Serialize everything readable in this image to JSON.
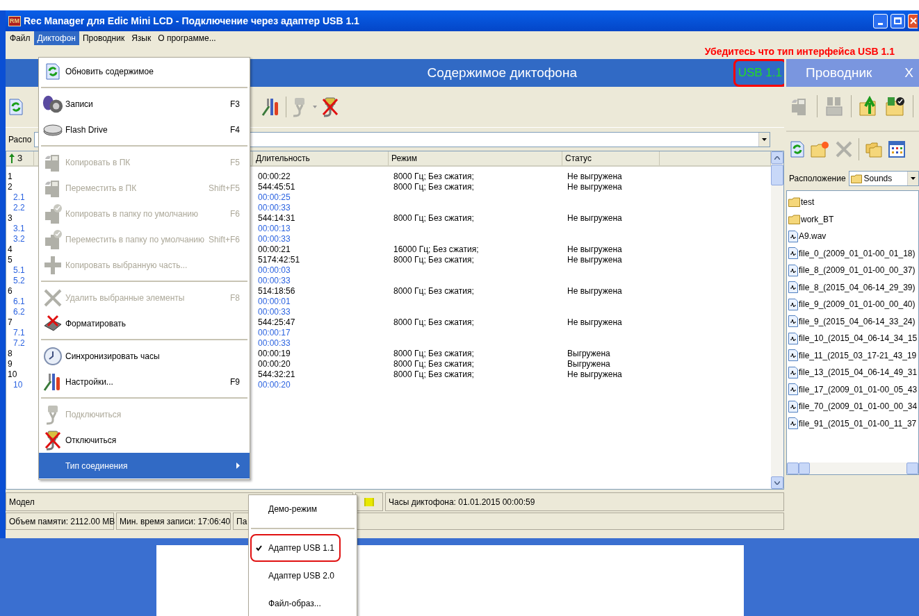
{
  "window": {
    "app_icon": "RM",
    "title": "Rec Manager для Edic Mini LCD - Подключение через адаптер USB 1.1"
  },
  "menu_bar": [
    {
      "label": "Файл",
      "selected": false
    },
    {
      "label": "Диктофон",
      "selected": true
    },
    {
      "label": "Проводник",
      "selected": false
    },
    {
      "label": "Язык",
      "selected": false
    },
    {
      "label": "О программе...",
      "selected": false
    }
  ],
  "annotation": "Убедитесь что тип интерфейса USB 1.1",
  "recorder": {
    "title": "Содержимое диктофона",
    "interface": "USB 1.1",
    "location_label": "Распо",
    "columns": [
      "З",
      "Длительность",
      "Режим",
      "Статус"
    ],
    "rows": [
      {
        "kind": "record",
        "number": "1",
        "duration": "00:00:22",
        "mode": "8000 Гц; Без сжатия;",
        "status": "Не выгружена"
      },
      {
        "kind": "record",
        "number": "2",
        "duration": "544:45:51",
        "mode": "8000 Гц; Без сжатия;",
        "status": "Не выгружена"
      },
      {
        "kind": "part",
        "number": "2.1",
        "duration": "00:00:25"
      },
      {
        "kind": "part",
        "number": "2.2",
        "duration": "00:00:33"
      },
      {
        "kind": "record",
        "number": "3",
        "duration": "544:14:31",
        "mode": "8000 Гц; Без сжатия;",
        "status": "Не выгружена"
      },
      {
        "kind": "part",
        "number": "3.1",
        "duration": "00:00:13"
      },
      {
        "kind": "part",
        "number": "3.2",
        "duration": "00:00:33"
      },
      {
        "kind": "record",
        "number": "4",
        "duration": "00:00:21",
        "mode": "16000 Гц; Без сжатия;",
        "status": "Не выгружена"
      },
      {
        "kind": "record",
        "number": "5",
        "duration": "5174:42:51",
        "mode": "8000 Гц; Без сжатия;",
        "status": "Не выгружена"
      },
      {
        "kind": "part",
        "number": "5.1",
        "duration": "00:00:03"
      },
      {
        "kind": "part",
        "number": "5.2",
        "duration": "00:00:33"
      },
      {
        "kind": "record",
        "number": "6",
        "duration": "514:18:56",
        "mode": "8000 Гц; Без сжатия;",
        "status": "Не выгружена"
      },
      {
        "kind": "part",
        "number": "6.1",
        "duration": "00:00:01"
      },
      {
        "kind": "part",
        "number": "6.2",
        "duration": "00:00:33"
      },
      {
        "kind": "record",
        "number": "7",
        "duration": "544:25:47",
        "mode": "8000 Гц; Без сжатия;",
        "status": "Не выгружена"
      },
      {
        "kind": "part",
        "number": "7.1",
        "duration": "00:00:17"
      },
      {
        "kind": "part",
        "number": "7.2",
        "duration": "00:00:33"
      },
      {
        "kind": "record",
        "number": "8",
        "duration": "00:00:19",
        "mode": "8000 Гц; Без сжатия;",
        "status": "Выгружена"
      },
      {
        "kind": "record",
        "number": "9",
        "duration": "00:00:20",
        "mode": "8000 Гц; Без сжатия;",
        "status": "Выгружена"
      },
      {
        "kind": "record",
        "number": "10",
        "duration": "544:32:21",
        "mode": "8000 Гц; Без сжатия;",
        "status": "Не выгружена"
      },
      {
        "kind": "part",
        "number": "10",
        "duration": "00:00:20"
      }
    ]
  },
  "status_bar": {
    "line1": [
      "Модел",
      "Часы диктофона: 01.01.2015 00:00:59"
    ],
    "line2": [
      "Объем памяти: 2112.00 MB",
      "Мин. время записи: 17:06:40",
      "Па"
    ]
  },
  "explorer": {
    "title": "Проводник",
    "close": "X",
    "location_label": "Расположение",
    "location": "Sounds",
    "items": [
      {
        "kind": "folder",
        "name": "test"
      },
      {
        "kind": "folder",
        "name": "work_BT"
      },
      {
        "kind": "file",
        "name": "A9.wav"
      },
      {
        "kind": "file",
        "name": "file_0_(2009_01_01-00_01_18)"
      },
      {
        "kind": "file",
        "name": "file_8_(2009_01_01-00_00_37)"
      },
      {
        "kind": "file",
        "name": "file_8_(2015_04_06-14_29_39)"
      },
      {
        "kind": "file",
        "name": "file_9_(2009_01_01-00_00_40)"
      },
      {
        "kind": "file",
        "name": "file_9_(2015_04_06-14_33_24)"
      },
      {
        "kind": "file",
        "name": "file_10_(2015_04_06-14_34_15"
      },
      {
        "kind": "file",
        "name": "file_11_(2015_03_17-21_43_19"
      },
      {
        "kind": "file",
        "name": "file_13_(2015_04_06-14_49_31"
      },
      {
        "kind": "file",
        "name": "file_17_(2009_01_01-00_05_43"
      },
      {
        "kind": "file",
        "name": "file_70_(2009_01_01-00_00_34"
      },
      {
        "kind": "file",
        "name": "file_91_(2015_01_01-00_11_37"
      }
    ]
  },
  "menu": [
    {
      "kind": "item",
      "label": "Обновить содержимое",
      "disabled": false,
      "selected": false
    },
    {
      "kind": "separator"
    },
    {
      "kind": "item",
      "label": "Записи",
      "shortcut": "F3",
      "disabled": false,
      "selected": false
    },
    {
      "kind": "item",
      "label": "Flash Drive",
      "shortcut": "F4",
      "disabled": false,
      "selected": false
    },
    {
      "kind": "separator"
    },
    {
      "kind": "item",
      "label": "Копировать в ПК",
      "shortcut": "F5",
      "disabled": true,
      "selected": false
    },
    {
      "kind": "item",
      "label": "Переместить в ПК",
      "shortcut": "Shift+F5",
      "disabled": true,
      "selected": false
    },
    {
      "kind": "item",
      "label": "Копировать в папку по умолчанию",
      "shortcut": "F6",
      "disabled": true,
      "selected": false
    },
    {
      "kind": "item",
      "label": "Переместить в папку по умолчанию",
      "shortcut": "Shift+F6",
      "disabled": true,
      "selected": false
    },
    {
      "kind": "item",
      "label": "Копировать выбранную часть...",
      "disabled": true,
      "selected": false
    },
    {
      "kind": "separator"
    },
    {
      "kind": "item",
      "label": "Удалить выбранные элементы",
      "shortcut": "F8",
      "disabled": true,
      "selected": false
    },
    {
      "kind": "item",
      "label": "Форматировать",
      "disabled": false,
      "selected": false
    },
    {
      "kind": "separator"
    },
    {
      "kind": "item",
      "label": "Синхронизировать часы",
      "disabled": false,
      "selected": false
    },
    {
      "kind": "item",
      "label": "Настройки...",
      "shortcut": "F9",
      "disabled": false,
      "selected": false
    },
    {
      "kind": "separator"
    },
    {
      "kind": "item",
      "label": "Подключиться",
      "disabled": true,
      "selected": false
    },
    {
      "kind": "item",
      "label": "Отключиться",
      "disabled": false,
      "selected": false
    },
    {
      "kind": "item",
      "label": "Тип соединения",
      "disabled": false,
      "selected": true,
      "has_submenu": true
    }
  ],
  "submenu": [
    {
      "kind": "item",
      "label": "Демо-режим",
      "checked": false
    },
    {
      "kind": "separator"
    },
    {
      "kind": "item",
      "label": "Адаптер USB 1.1",
      "checked": true
    },
    {
      "kind": "item",
      "label": "Адаптер USB 2.0",
      "checked": false
    },
    {
      "kind": "item",
      "label": "Файл-образ...",
      "checked": false
    }
  ]
}
